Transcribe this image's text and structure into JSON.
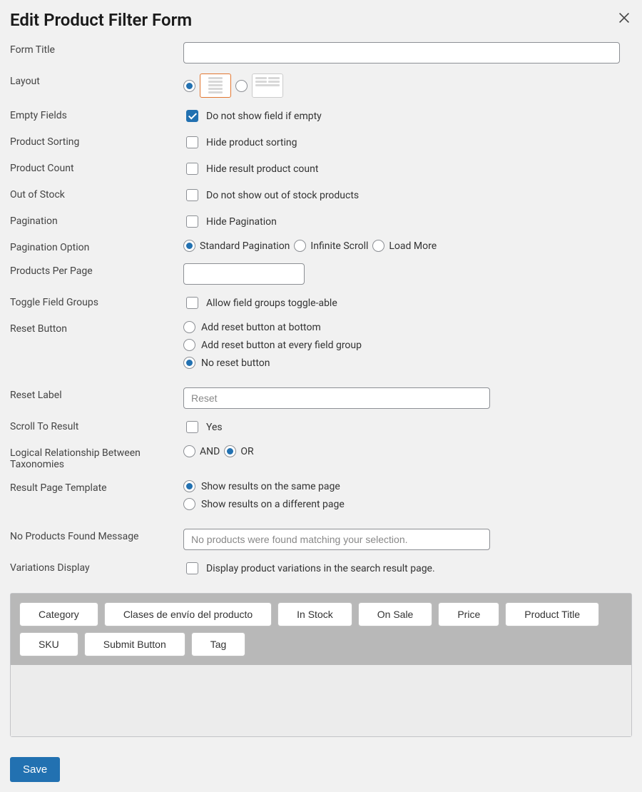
{
  "header": {
    "title": "Edit Product Filter Form"
  },
  "fields": {
    "form_title_label": "Form Title",
    "form_title_value": "",
    "layout_label": "Layout",
    "empty_fields_label": "Empty Fields",
    "empty_fields_cb": "Do not show field if empty",
    "product_sorting_label": "Product Sorting",
    "product_sorting_cb": "Hide product sorting",
    "product_count_label": "Product Count",
    "product_count_cb": "Hide result product count",
    "out_of_stock_label": "Out of Stock",
    "out_of_stock_cb": "Do not show out of stock products",
    "pagination_label": "Pagination",
    "pagination_cb": "Hide Pagination",
    "pagination_option_label": "Pagination Option",
    "pagination_option_standard": "Standard Pagination",
    "pagination_option_infinite": "Infinite Scroll",
    "pagination_option_loadmore": "Load More",
    "ppp_label": "Products Per Page",
    "ppp_value": "",
    "toggle_groups_label": "Toggle Field Groups",
    "toggle_groups_cb": "Allow field groups toggle-able",
    "reset_button_label": "Reset Button",
    "reset_bottom": "Add reset button at bottom",
    "reset_every": "Add reset button at every field group",
    "reset_none": "No reset button",
    "reset_label_label": "Reset Label",
    "reset_label_placeholder": "Reset",
    "reset_label_value": "",
    "scroll_label": "Scroll To Result",
    "scroll_cb": "Yes",
    "logic_label": "Logical Relationship Between Taxonomies",
    "logic_and": "AND",
    "logic_or": "OR",
    "result_tpl_label": "Result Page Template",
    "result_same": "Show results on the same page",
    "result_diff": "Show results on a different page",
    "noprod_label": "No Products Found Message",
    "noprod_placeholder": "No products were found matching your selection.",
    "noprod_value": "",
    "variations_label": "Variations Display",
    "variations_cb": "Display product variations in the search result page."
  },
  "tags": [
    "Category",
    "Clases de envío del producto",
    "In Stock",
    "On Sale",
    "Price",
    "Product Title",
    "SKU",
    "Submit Button",
    "Tag"
  ],
  "save_label": "Save"
}
